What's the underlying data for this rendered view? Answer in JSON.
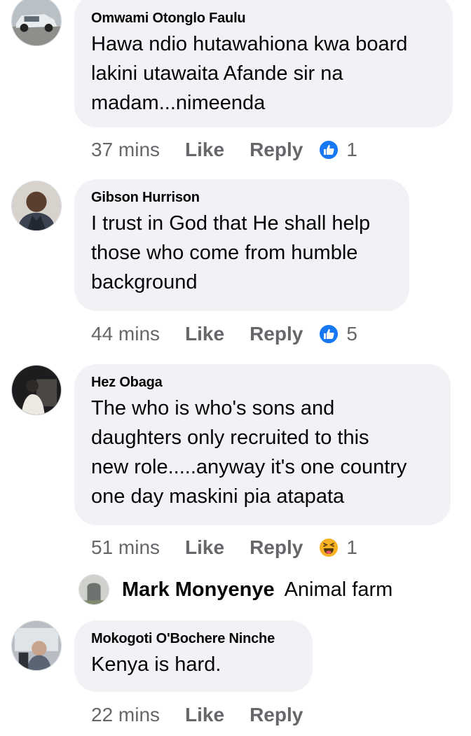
{
  "comments": [
    {
      "author": "Omwami Otonglo Faulu",
      "text": "Hawa ndio hutawahiona kwa board lakini utawaita Afande sir na madam...nimeenda",
      "lines": [
        "Hawa ndio hutawahiona kwa board",
        "lakini utawaita Afande sir na",
        "madam...nimeenda"
      ],
      "time": "37 mins",
      "like_label": "Like",
      "reply_label": "Reply",
      "reaction_icon": "like-icon",
      "reaction_count": "1"
    },
    {
      "author": "Gibson Hurrison",
      "lines": [
        "I trust in God that He shall help",
        "those who come from humble",
        "background"
      ],
      "time": "44 mins",
      "like_label": "Like",
      "reply_label": "Reply",
      "reaction_icon": "like-icon",
      "reaction_count": "5"
    },
    {
      "author": "Hez Obaga",
      "lines": [
        "The who is who's sons and",
        "daughters only recruited to this",
        "new role.....anyway it's one country",
        "one day maskini pia atapata"
      ],
      "time": "51 mins",
      "like_label": "Like",
      "reply_label": "Reply",
      "reaction_icon": "haha-icon",
      "reaction_count": "1"
    },
    {
      "author": "Mokogoti O'Bochere Ninche",
      "lines": [
        "Kenya is hard."
      ],
      "time": "22 mins",
      "like_label": "Like",
      "reply_label": "Reply"
    }
  ],
  "reply": {
    "author": "Mark Monyenye",
    "text": "Animal farm"
  },
  "colors": {
    "bubble": "#f0f2f5",
    "meta_text": "#65676b",
    "like_blue": "#1877f2",
    "haha_yellow": "#f7b125"
  }
}
